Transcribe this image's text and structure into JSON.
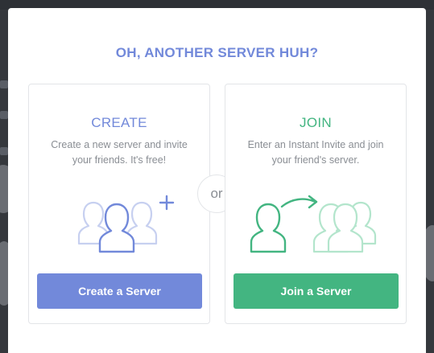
{
  "modal": {
    "title": "OH, ANOTHER SERVER HUH?"
  },
  "create": {
    "heading": "CREATE",
    "description": "Create a new server and invite your friends. It's free!",
    "button_label": "Create a Server",
    "accent_color": "#7289da",
    "illustration_icon": "users-plus-icon"
  },
  "join": {
    "heading": "JOIN",
    "description": "Enter an Instant Invite and join your friend's server.",
    "button_label": "Join a Server",
    "accent_color": "#43b581",
    "illustration_icon": "user-join-group-icon"
  },
  "divider": {
    "label": "or"
  }
}
